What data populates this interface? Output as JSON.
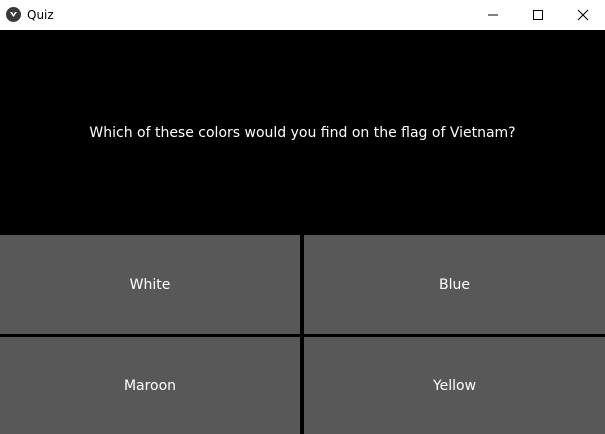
{
  "window": {
    "title": "Quiz",
    "app_icon": "kivy-logo-icon",
    "controls": [
      "minimize-icon",
      "maximize-icon",
      "close-icon"
    ]
  },
  "question": {
    "text": "Which of these colors would you find on the flag of Vietnam?"
  },
  "answers": [
    {
      "label": "White"
    },
    {
      "label": "Blue"
    },
    {
      "label": "Maroon"
    },
    {
      "label": "Yellow"
    }
  ],
  "colors": {
    "background": "#000000",
    "button": "#585858",
    "text": "#ffffff",
    "titlebar": "#ffffff"
  }
}
